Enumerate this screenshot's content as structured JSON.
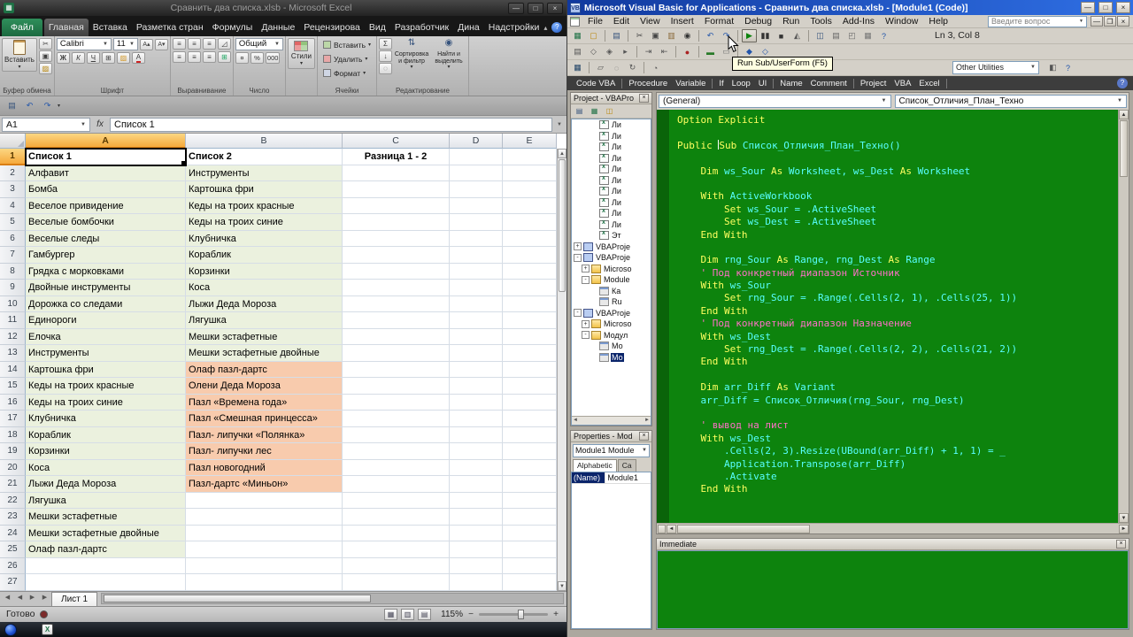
{
  "chrome": {
    "minimize": "—",
    "maximize": "□",
    "close": "×",
    "restore": "❐"
  },
  "excel": {
    "title": "Сравнить два списка.xlsb - Microsoft Excel",
    "tabs": [
      {
        "label": "Файл",
        "file": true
      },
      {
        "label": "Главная",
        "active": true
      },
      {
        "label": "Вставка"
      },
      {
        "label": "Разметка стран"
      },
      {
        "label": "Формулы"
      },
      {
        "label": "Данные"
      },
      {
        "label": "Рецензирова"
      },
      {
        "label": "Вид"
      },
      {
        "label": "Разработчик"
      },
      {
        "label": "Дина"
      },
      {
        "label": "Надстройки"
      }
    ],
    "ribbon": {
      "paste_label": "Вставить",
      "font_name": "Calibri",
      "font_size": "11",
      "bold": "Ж",
      "italic": "К",
      "underline": "Ч",
      "number_format": "Общий",
      "number_buttons": [
        "¤",
        "%",
        "000"
      ],
      "styles_label": "Стили",
      "cells_buttons": [
        "Вставить",
        "Удалить",
        "Формат"
      ],
      "sort_filter": "Сортировка и фильтр",
      "find_select": "Найти и выделить",
      "group_labels": {
        "clipboard": "Буфер обмена",
        "font": "Шрифт",
        "alignment": "Выравнивание",
        "number": "Число",
        "cells": "Ячейки",
        "editing": "Редактирование"
      }
    },
    "qat_icons": [
      "save-icon",
      "undo-icon",
      "redo-icon"
    ],
    "name_box": "A1",
    "formula": "Список 1",
    "grid": {
      "columns": [
        "A",
        "B",
        "C",
        "D",
        "E"
      ],
      "selected_column": "A",
      "rows": [
        {
          "n": 1,
          "a": "Список 1",
          "b": "Список 2",
          "c": "Разница 1 - 2",
          "hdr": true,
          "sel": true
        },
        {
          "n": 2,
          "a": "Алфавит",
          "b": "Инструменты",
          "fa": "g",
          "fb": "g"
        },
        {
          "n": 3,
          "a": "Бомба",
          "b": "Картошка фри",
          "fa": "g",
          "fb": "g"
        },
        {
          "n": 4,
          "a": "Веселое привидение",
          "b": "Кеды на троих красные",
          "fa": "g",
          "fb": "g"
        },
        {
          "n": 5,
          "a": "Веселые бомбочки",
          "b": "Кеды на троих синие",
          "fa": "g",
          "fb": "g"
        },
        {
          "n": 6,
          "a": "Веселые следы",
          "b": "Клубничка",
          "fa": "g",
          "fb": "g"
        },
        {
          "n": 7,
          "a": "Гамбургер",
          "b": "Кораблик",
          "fa": "g",
          "fb": "g"
        },
        {
          "n": 8,
          "a": "Грядка с морковками",
          "b": "Корзинки",
          "fa": "g",
          "fb": "g"
        },
        {
          "n": 9,
          "a": "Двойные инструменты",
          "b": "Коса",
          "fa": "g",
          "fb": "g"
        },
        {
          "n": 10,
          "a": "Дорожка со следами",
          "b": "Лыжи Деда Мороза",
          "fa": "g",
          "fb": "g"
        },
        {
          "n": 11,
          "a": "Единороги",
          "b": "Лягушка",
          "fa": "g",
          "fb": "g"
        },
        {
          "n": 12,
          "a": "Елочка",
          "b": "Мешки эстафетные",
          "fa": "g",
          "fb": "g"
        },
        {
          "n": 13,
          "a": "Инструменты",
          "b": "Мешки эстафетные двойные",
          "fa": "g",
          "fb": "g"
        },
        {
          "n": 14,
          "a": "Картошка фри",
          "b": "Олаф пазл-дартс",
          "fa": "g",
          "fb": "p"
        },
        {
          "n": 15,
          "a": "Кеды на троих красные",
          "b": "Олени Деда Мороза",
          "fa": "g",
          "fb": "p"
        },
        {
          "n": 16,
          "a": "Кеды на троих синие",
          "b": "Пазл «Времена года»",
          "fa": "g",
          "fb": "p"
        },
        {
          "n": 17,
          "a": "Клубничка",
          "b": "Пазл «Смешная принцесса»",
          "fa": "g",
          "fb": "p"
        },
        {
          "n": 18,
          "a": "Кораблик",
          "b": "Пазл- липучки «Полянка»",
          "fa": "g",
          "fb": "p"
        },
        {
          "n": 19,
          "a": "Корзинки",
          "b": "Пазл- липучки лес",
          "fa": "g",
          "fb": "p"
        },
        {
          "n": 20,
          "a": "Коса",
          "b": "Пазл новогодний",
          "fa": "g",
          "fb": "p"
        },
        {
          "n": 21,
          "a": "Лыжи Деда Мороза",
          "b": "Пазл-дартс «Миньон»",
          "fa": "g",
          "fb": "p"
        },
        {
          "n": 22,
          "a": "Лягушка",
          "fa": "g"
        },
        {
          "n": 23,
          "a": "Мешки эстафетные",
          "fa": "g"
        },
        {
          "n": 24,
          "a": "Мешки эстафетные двойные",
          "fa": "g"
        },
        {
          "n": 25,
          "a": "Олаф пазл-дартс",
          "fa": "g"
        },
        {
          "n": 26
        },
        {
          "n": 27
        }
      ]
    },
    "sheet_tab": "Лист 1",
    "status": {
      "ready": "Готово",
      "zoom": "115%"
    }
  },
  "vba": {
    "title": "Microsoft Visual Basic for Applications - Сравнить два списка.xlsb - [Module1 (Code)]",
    "menu": [
      "File",
      "Edit",
      "View",
      "Insert",
      "Format",
      "Debug",
      "Run",
      "Tools",
      "Add-Ins",
      "Window",
      "Help"
    ],
    "help_box": "Введите вопрос",
    "line_col": "Ln 3, Col 8",
    "tooltip": "Run Sub/UserForm (F5)",
    "other_utilities": "Other Utilities",
    "toolbar_standard": [
      "view-excel-icon",
      "insert-userform-icon",
      "sep",
      "save-icon",
      "sep",
      "cut-icon",
      "copy-icon",
      "paste-icon",
      "find-icon",
      "sep",
      "undo-icon",
      "redo-icon",
      "sep",
      "run-icon",
      "break-icon",
      "reset-icon",
      "design-mode-icon",
      "sep",
      "project-explorer-icon",
      "properties-window-icon",
      "object-browser-icon",
      "toolbox-icon",
      "help-icon"
    ],
    "toolbar_edit": [
      "list-properties-icon",
      "quick-info-icon",
      "parameter-info-icon",
      "complete-word-icon",
      "sep",
      "indent-icon",
      "outdent-icon",
      "sep",
      "toggle-breakpoint-icon",
      "sep",
      "comment-block-icon",
      "uncomment-block-icon",
      "sep",
      "bookmark-icon",
      "next-bookmark-icon"
    ],
    "toolbar_utilities": [
      "codevba-menu-icon",
      "sep",
      "snippet-icon",
      "tooltip-vba-icon",
      "rebuild-icon",
      "sep",
      "settings-icon"
    ],
    "toolbar_utilities_right": [
      "fix-icon",
      "help-icon"
    ],
    "codebar": [
      "Code VBA",
      "|",
      "Procedure",
      "Variable",
      "|",
      "If",
      "Loop",
      "UI",
      "|",
      "Name",
      "Comment",
      "|",
      "Project",
      "VBA",
      "Excel",
      "|"
    ],
    "project": {
      "title": "Project - VBAPro",
      "tools": [
        "view-code-icon",
        "view-object-icon",
        "toggle-folders-icon"
      ],
      "tree": [
        {
          "icon": "sheet-icon",
          "label": "Ли",
          "ind": 2
        },
        {
          "icon": "sheet-icon",
          "label": "Ли",
          "ind": 2
        },
        {
          "icon": "sheet-icon",
          "label": "Ли",
          "ind": 2
        },
        {
          "icon": "sheet-icon",
          "label": "Ли",
          "ind": 2
        },
        {
          "icon": "sheet-icon",
          "label": "Ли",
          "ind": 2
        },
        {
          "icon": "sheet-icon",
          "label": "Ли",
          "ind": 2
        },
        {
          "icon": "sheet-icon",
          "label": "Ли",
          "ind": 2
        },
        {
          "icon": "sheet-icon",
          "label": "Ли",
          "ind": 2
        },
        {
          "icon": "sheet-icon",
          "label": "Ли",
          "ind": 2
        },
        {
          "icon": "sheet-icon",
          "label": "Ли",
          "ind": 2
        },
        {
          "icon": "sheet-icon",
          "label": "Эт",
          "ind": 2
        },
        {
          "exp": "+",
          "icon": "project-icon",
          "label": "VBAProje",
          "ind": 0
        },
        {
          "exp": "-",
          "icon": "project-icon",
          "label": "VBAProje",
          "ind": 0
        },
        {
          "exp": "+",
          "icon": "folder-icon",
          "label": "Microso",
          "ind": 1
        },
        {
          "exp": "-",
          "icon": "folder-icon",
          "label": "Module",
          "ind": 1
        },
        {
          "icon": "module-icon",
          "label": "Ка",
          "ind": 2
        },
        {
          "icon": "module-icon",
          "label": "Ru",
          "ind": 2
        },
        {
          "exp": "-",
          "icon": "project-icon",
          "label": "VBAProje",
          "ind": 0
        },
        {
          "exp": "+",
          "icon": "folder-icon",
          "label": "Microso",
          "ind": 1
        },
        {
          "exp": "-",
          "icon": "folder-icon",
          "label": "Модул",
          "ind": 1
        },
        {
          "icon": "module-icon",
          "label": "Мо",
          "ind": 2
        },
        {
          "icon": "module-icon",
          "label": "Мо",
          "ind": 2,
          "sel": true
        }
      ]
    },
    "properties": {
      "title": "Properties - Mod",
      "selector": "Module1 Module",
      "tab_alphabetic": "Alphabetic",
      "tab_categorized": "Ca",
      "rows": [
        {
          "key": "(Name)",
          "value": "Module1"
        }
      ]
    },
    "code": {
      "left_combo": "(General)",
      "right_combo": "Список_Отличия_План_Техно",
      "lines": [
        [
          [
            "k",
            "Option Explicit"
          ]
        ],
        [],
        [
          [
            "k",
            "Public "
          ],
          [
            "caret",
            ""
          ],
          [
            "k",
            "Sub "
          ],
          [
            "i",
            "Список_Отличия_План_Техно()"
          ]
        ],
        [],
        [
          [
            "i",
            "    "
          ],
          [
            "k",
            "Dim "
          ],
          [
            "i",
            "ws_Sour "
          ],
          [
            "k",
            "As "
          ],
          [
            "i",
            "Worksheet, ws_Dest "
          ],
          [
            "k",
            "As "
          ],
          [
            "i",
            "Worksheet"
          ]
        ],
        [],
        [
          [
            "i",
            "    "
          ],
          [
            "k",
            "With "
          ],
          [
            "i",
            "ActiveWorkbook"
          ]
        ],
        [
          [
            "i",
            "        "
          ],
          [
            "k",
            "Set "
          ],
          [
            "i",
            "ws_Sour = .ActiveSheet"
          ]
        ],
        [
          [
            "i",
            "        "
          ],
          [
            "k",
            "Set "
          ],
          [
            "i",
            "ws_Dest = .ActiveSheet"
          ]
        ],
        [
          [
            "i",
            "    "
          ],
          [
            "k",
            "End With"
          ]
        ],
        [],
        [
          [
            "i",
            "    "
          ],
          [
            "k",
            "Dim "
          ],
          [
            "i",
            "rng_Sour "
          ],
          [
            "k",
            "As "
          ],
          [
            "i",
            "Range, rng_Dest "
          ],
          [
            "k",
            "As "
          ],
          [
            "i",
            "Range"
          ]
        ],
        [
          [
            "i",
            "    "
          ],
          [
            "c",
            "' Под конкретный диапазон Источник"
          ]
        ],
        [
          [
            "i",
            "    "
          ],
          [
            "k",
            "With "
          ],
          [
            "i",
            "ws_Sour"
          ]
        ],
        [
          [
            "i",
            "        "
          ],
          [
            "k",
            "Set "
          ],
          [
            "i",
            "rng_Sour = .Range(.Cells(2, 1), .Cells(25, 1))"
          ]
        ],
        [
          [
            "i",
            "    "
          ],
          [
            "k",
            "End With"
          ]
        ],
        [
          [
            "i",
            "    "
          ],
          [
            "c",
            "' Под конкретный диапазон Назначение"
          ]
        ],
        [
          [
            "i",
            "    "
          ],
          [
            "k",
            "With "
          ],
          [
            "i",
            "ws_Dest"
          ]
        ],
        [
          [
            "i",
            "        "
          ],
          [
            "k",
            "Set "
          ],
          [
            "i",
            "rng_Dest = .Range(.Cells(2, 2), .Cells(21, 2))"
          ]
        ],
        [
          [
            "i",
            "    "
          ],
          [
            "k",
            "End With"
          ]
        ],
        [],
        [
          [
            "i",
            "    "
          ],
          [
            "k",
            "Dim "
          ],
          [
            "i",
            "arr_Diff "
          ],
          [
            "k",
            "As "
          ],
          [
            "i",
            "Variant"
          ]
        ],
        [
          [
            "i",
            "    "
          ],
          [
            "i",
            "arr_Diff = Список_Отличия(rng_Sour, rng_Dest)"
          ]
        ],
        [],
        [
          [
            "i",
            "    "
          ],
          [
            "c",
            "' вывод на лист"
          ]
        ],
        [
          [
            "i",
            "    "
          ],
          [
            "k",
            "With "
          ],
          [
            "i",
            "ws_Dest"
          ]
        ],
        [
          [
            "i",
            "        "
          ],
          [
            "i",
            ".Cells(2, 3).Resize(UBound(arr_Diff) + 1, 1) = _"
          ]
        ],
        [
          [
            "i",
            "        "
          ],
          [
            "i",
            "Application.Transpose(arr_Diff)"
          ]
        ],
        [
          [
            "i",
            "        "
          ],
          [
            "i",
            ".Activate"
          ]
        ],
        [
          [
            "i",
            "    "
          ],
          [
            "k",
            "End With"
          ]
        ]
      ]
    },
    "immediate_title": "Immediate"
  }
}
